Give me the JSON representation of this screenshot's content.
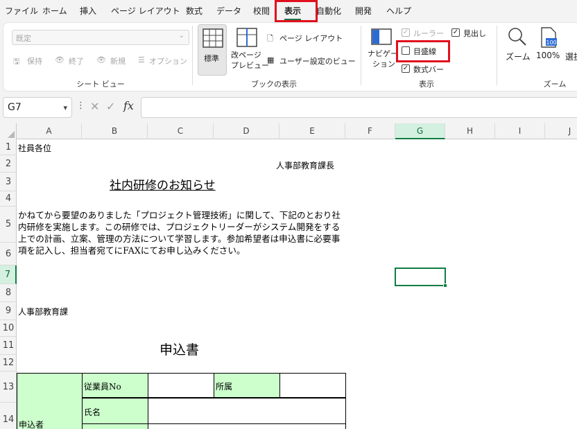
{
  "menu": {
    "items": [
      "ファイル",
      "ホーム",
      "挿入",
      "ページ レイアウト",
      "数式",
      "データ",
      "校閲",
      "表示",
      "自動化",
      "開発",
      "ヘルプ"
    ],
    "active": "表示"
  },
  "ribbon": {
    "sheet_view": {
      "dropdown_value": "既定",
      "keep": "保持",
      "exit": "終了",
      "new": "新規",
      "options": "オプション",
      "group_label": "シート ビュー"
    },
    "workbook_views": {
      "normal": "標準",
      "page_break_line1": "改ページ",
      "page_break_line2": "プレビュー",
      "page_layout": "ページ レイアウト",
      "custom_views": "ユーザー設定のビュー",
      "group_label": "ブックの表示"
    },
    "show": {
      "navigation_line1": "ナビゲー",
      "navigation_line2": "ション",
      "ruler": "ルーラー",
      "ruler_checked": true,
      "gridlines": "目盛線",
      "gridlines_checked": false,
      "formula_bar": "数式バー",
      "formula_bar_checked": true,
      "headings": "見出し",
      "headings_checked": true,
      "group_label": "表示"
    },
    "zoom": {
      "zoom": "ズーム",
      "hundred": "100%",
      "hundred_icon_text": "100",
      "selection": "選択",
      "group_label": "ズーム"
    }
  },
  "formula_bar": {
    "name_box": "G7",
    "fx": "fx",
    "content": ""
  },
  "grid": {
    "columns": [
      "A",
      "B",
      "C",
      "D",
      "E",
      "F",
      "G",
      "H",
      "I",
      "J"
    ],
    "rows": [
      "1",
      "2",
      "3",
      "4",
      "5",
      "6",
      "7",
      "8",
      "9",
      "10",
      "11",
      "12",
      "13",
      "14"
    ],
    "selected_cell": "G7"
  },
  "document": {
    "recipient": "社員各位",
    "sender": "人事部教育課長",
    "title": "社内研修のお知らせ",
    "body": "かねてから要望のありました「プロジェクト管理技術」に関して、下記のとおり社内研修を実施します。この研修では、プロジェクトリーダーがシステム開発をする上での計画、立案、管理の方法について学習します。参加希望者は申込書に必要事項を記入し、担当者宛てにFAXにてお申し込みください。",
    "department": "人事部教育課",
    "form_title": "申込書",
    "form": {
      "applicant": "申込者",
      "employee_no": "従業員No",
      "affiliation": "所属",
      "name": "氏名"
    }
  }
}
